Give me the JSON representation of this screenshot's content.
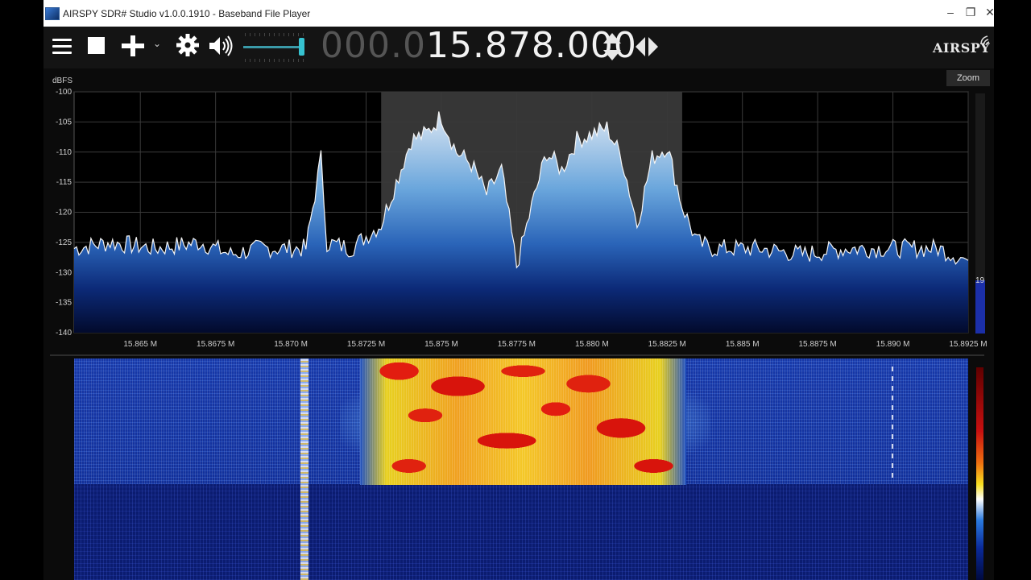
{
  "window": {
    "title": "AIRSPY SDR# Studio v1.0.0.1910 - Baseband File Player",
    "minimize_glyph": "–",
    "restore_glyph": "❐",
    "close_glyph": "✕"
  },
  "toolbar": {
    "menu_icon": "hamburger-icon",
    "stop_icon": "stop-icon",
    "add_icon": "plus-icon",
    "add_menu_glyph": "⌄",
    "settings_icon": "gear-icon",
    "audio_icon": "speaker-icon",
    "volume_level": 0.95,
    "frequency_prefix": "000.0",
    "frequency_main": "15.878.000",
    "tune_step_icon": "up-down-arrows-icon",
    "band_nav_icon": "left-right-arrows-icon",
    "logo_text": "AIRSPY"
  },
  "spectrum": {
    "zoom_label": "Zoom",
    "ylabel": "dBFS",
    "level_value": "19",
    "level_fraction": 0.22
  },
  "chart_data": {
    "type": "area",
    "title": "",
    "ylabel": "dBFS",
    "xlabel": "",
    "x_unit": "MHz",
    "xlim": [
      15.8628,
      15.8925
    ],
    "ylim": [
      -140,
      -100
    ],
    "yticks": [
      "-100",
      "-105",
      "-110",
      "-115",
      "-120",
      "-125",
      "-130",
      "-135",
      "-140"
    ],
    "ytick_values": [
      -100,
      -105,
      -110,
      -115,
      -120,
      -125,
      -130,
      -135,
      -140
    ],
    "xticks": [
      "15.865 M",
      "15.8675 M",
      "15.870 M",
      "15.8725 M",
      "15.875 M",
      "15.8775 M",
      "15.880 M",
      "15.8825 M",
      "15.885 M",
      "15.8875 M",
      "15.890 M",
      "15.8925 M"
    ],
    "xtick_values": [
      15.865,
      15.8675,
      15.87,
      15.8725,
      15.875,
      15.8775,
      15.88,
      15.8825,
      15.885,
      15.8875,
      15.89,
      15.8925
    ],
    "grid": true,
    "filter_band": [
      15.873,
      15.883
    ],
    "series": [
      {
        "x": [
          15.8628,
          15.864,
          15.8655,
          15.867,
          15.868,
          15.869,
          15.8705,
          15.8708,
          15.871,
          15.8712,
          15.872,
          15.873,
          15.8735,
          15.874,
          15.8745,
          15.875,
          15.8755,
          15.876,
          15.8765,
          15.877,
          15.8775,
          15.878,
          15.8785,
          15.879,
          15.8795,
          15.88,
          15.8805,
          15.881,
          15.8815,
          15.882,
          15.8825,
          15.883,
          15.8835,
          15.884,
          15.8855,
          15.887,
          15.8885,
          15.89,
          15.8915,
          15.8925
        ],
        "y": [
          -126,
          -125,
          -126,
          -125,
          -127,
          -126,
          -126,
          -117,
          -111,
          -125,
          -126,
          -122,
          -115,
          -108,
          -107,
          -104,
          -110,
          -112,
          -117,
          -113,
          -129,
          -119,
          -110,
          -113,
          -108,
          -107,
          -106,
          -111,
          -122,
          -111,
          -109,
          -119,
          -125,
          -126,
          -126,
          -127,
          -126,
          -126,
          -126,
          -128
        ]
      }
    ]
  },
  "waterfall": {
    "name": "waterfall-display"
  }
}
